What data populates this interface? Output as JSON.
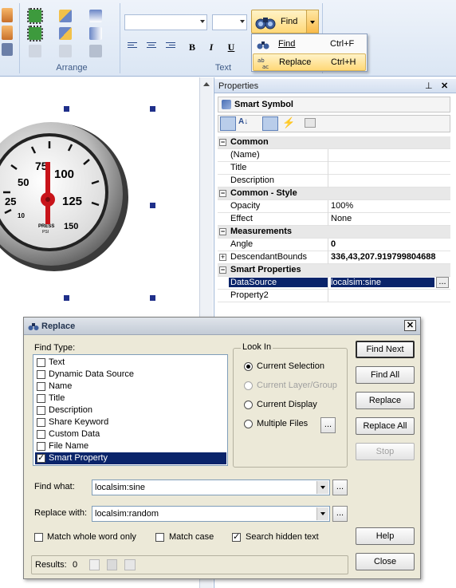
{
  "ribbon": {
    "arrange_label": "Arrange",
    "text_label": "Text",
    "find_label": "Find",
    "bold": "B",
    "italic": "I",
    "underline": "U"
  },
  "find_menu": {
    "items": [
      {
        "label": "Find",
        "shortcut": "Ctrl+F",
        "icon": "binoculars-icon"
      },
      {
        "label": "Replace",
        "shortcut": "Ctrl+H",
        "icon": "replace-icon"
      }
    ]
  },
  "gauge": {
    "ticks": [
      "10",
      "25",
      "50",
      "75",
      "100",
      "125",
      "150"
    ],
    "label": "PRESS",
    "unit": "PSI"
  },
  "properties": {
    "pane_title": "Properties",
    "object_name": "Smart Symbol",
    "rows": [
      {
        "type": "cat",
        "name": "Common",
        "value": ""
      },
      {
        "type": "prop",
        "name": "(Name)",
        "value": ""
      },
      {
        "type": "prop",
        "name": "Title",
        "value": ""
      },
      {
        "type": "prop",
        "name": "Description",
        "value": ""
      },
      {
        "type": "cat",
        "name": "Common - Style",
        "value": ""
      },
      {
        "type": "prop",
        "name": "Opacity",
        "value": "100%"
      },
      {
        "type": "prop",
        "name": "Effect",
        "value": "None"
      },
      {
        "type": "cat",
        "name": "Measurements",
        "value": ""
      },
      {
        "type": "prop",
        "name": "Angle",
        "value": "0"
      },
      {
        "type": "prop",
        "name": "DescendantBounds",
        "value": "336,43,207.919799804688"
      },
      {
        "type": "cat",
        "name": "Smart Properties",
        "value": ""
      },
      {
        "type": "prop",
        "name": "DataSource",
        "value": "localsim:sine"
      },
      {
        "type": "prop",
        "name": "Property2",
        "value": ""
      }
    ]
  },
  "dialog": {
    "title": "Replace",
    "find_type_label": "Find Type:",
    "find_types": [
      {
        "label": "Text",
        "checked": false
      },
      {
        "label": "Dynamic Data Source",
        "checked": false
      },
      {
        "label": "Name",
        "checked": false
      },
      {
        "label": "Title",
        "checked": false
      },
      {
        "label": "Description",
        "checked": false
      },
      {
        "label": "Share Keyword",
        "checked": false
      },
      {
        "label": "Custom Data",
        "checked": false
      },
      {
        "label": "File Name",
        "checked": false
      },
      {
        "label": "Smart Property",
        "checked": true
      }
    ],
    "look_in_label": "Look In",
    "look_in": [
      {
        "label": "Current Selection",
        "selected": true,
        "enabled": true
      },
      {
        "label": "Current Layer/Group",
        "selected": false,
        "enabled": false
      },
      {
        "label": "Current Display",
        "selected": false,
        "enabled": true
      },
      {
        "label": "Multiple Files",
        "selected": false,
        "enabled": true
      }
    ],
    "find_what_label": "Find what:",
    "find_what_value": "localsim:sine",
    "replace_with_label": "Replace with:",
    "replace_with_value": "localsim:random",
    "match_whole_word": "Match whole word only",
    "match_case": "Match case",
    "search_hidden": "Search hidden text",
    "results_label": "Results:",
    "results_count": "0",
    "buttons": {
      "find_next": "Find Next",
      "find_all": "Find All",
      "replace": "Replace",
      "replace_all": "Replace All",
      "stop": "Stop",
      "help": "Help",
      "close": "Close"
    },
    "ellipsis": "..."
  }
}
